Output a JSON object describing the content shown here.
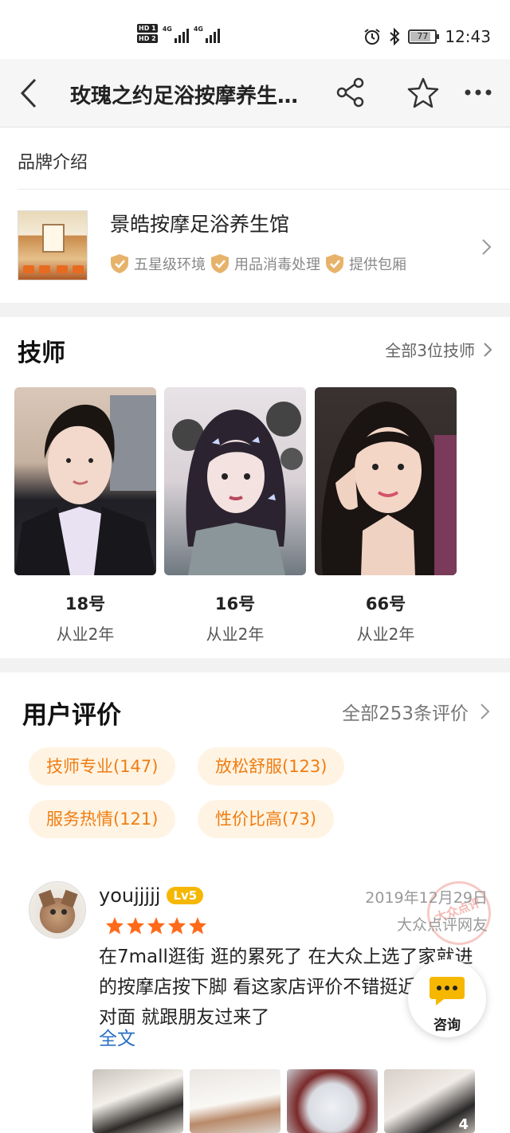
{
  "status_bar": {
    "hd1": "HD 1",
    "hd2": "HD 2",
    "net1": "4G",
    "net2": "4G",
    "battery": "77",
    "time": "12:43"
  },
  "nav": {
    "title": "玫瑰之约足浴按摩养生…"
  },
  "brand": {
    "heading": "品牌介绍",
    "name": "景皓按摩足浴养生馆",
    "tags": [
      "五星级环境",
      "用品消毒处理",
      "提供包厢"
    ]
  },
  "technicians": {
    "title": "技师",
    "all_label": "全部3位技师",
    "items": [
      {
        "number": "18号",
        "years": "从业2年"
      },
      {
        "number": "16号",
        "years": "从业2年"
      },
      {
        "number": "66号",
        "years": "从业2年"
      }
    ]
  },
  "reviews": {
    "title": "用户评价",
    "all_label": "全部253条评价",
    "chips": [
      "技师专业(147)",
      "放松舒服(123)",
      "服务热情(121)",
      "性价比高(73)"
    ],
    "review": {
      "username": "youjjjjj",
      "level": "Lv5",
      "rating": 5,
      "date": "2019年12月29日",
      "source": "大众点评网友",
      "stamp": "大众点评",
      "text": "在7mall逛街 逛的累死了 在大众上选了家就进的按摩店按下脚 看这家店评价不错挺近的就在对面 就跟朋友过来了",
      "more_label": "全文",
      "photo_count": "4"
    },
    "consult_label": "咨询"
  },
  "colors": {
    "accent_orange": "#ef7d12",
    "chip_bg": "#fff4e3",
    "star": "#ff6a1a",
    "link_blue": "#2a6fc4",
    "level_badge": "#f5b700"
  }
}
